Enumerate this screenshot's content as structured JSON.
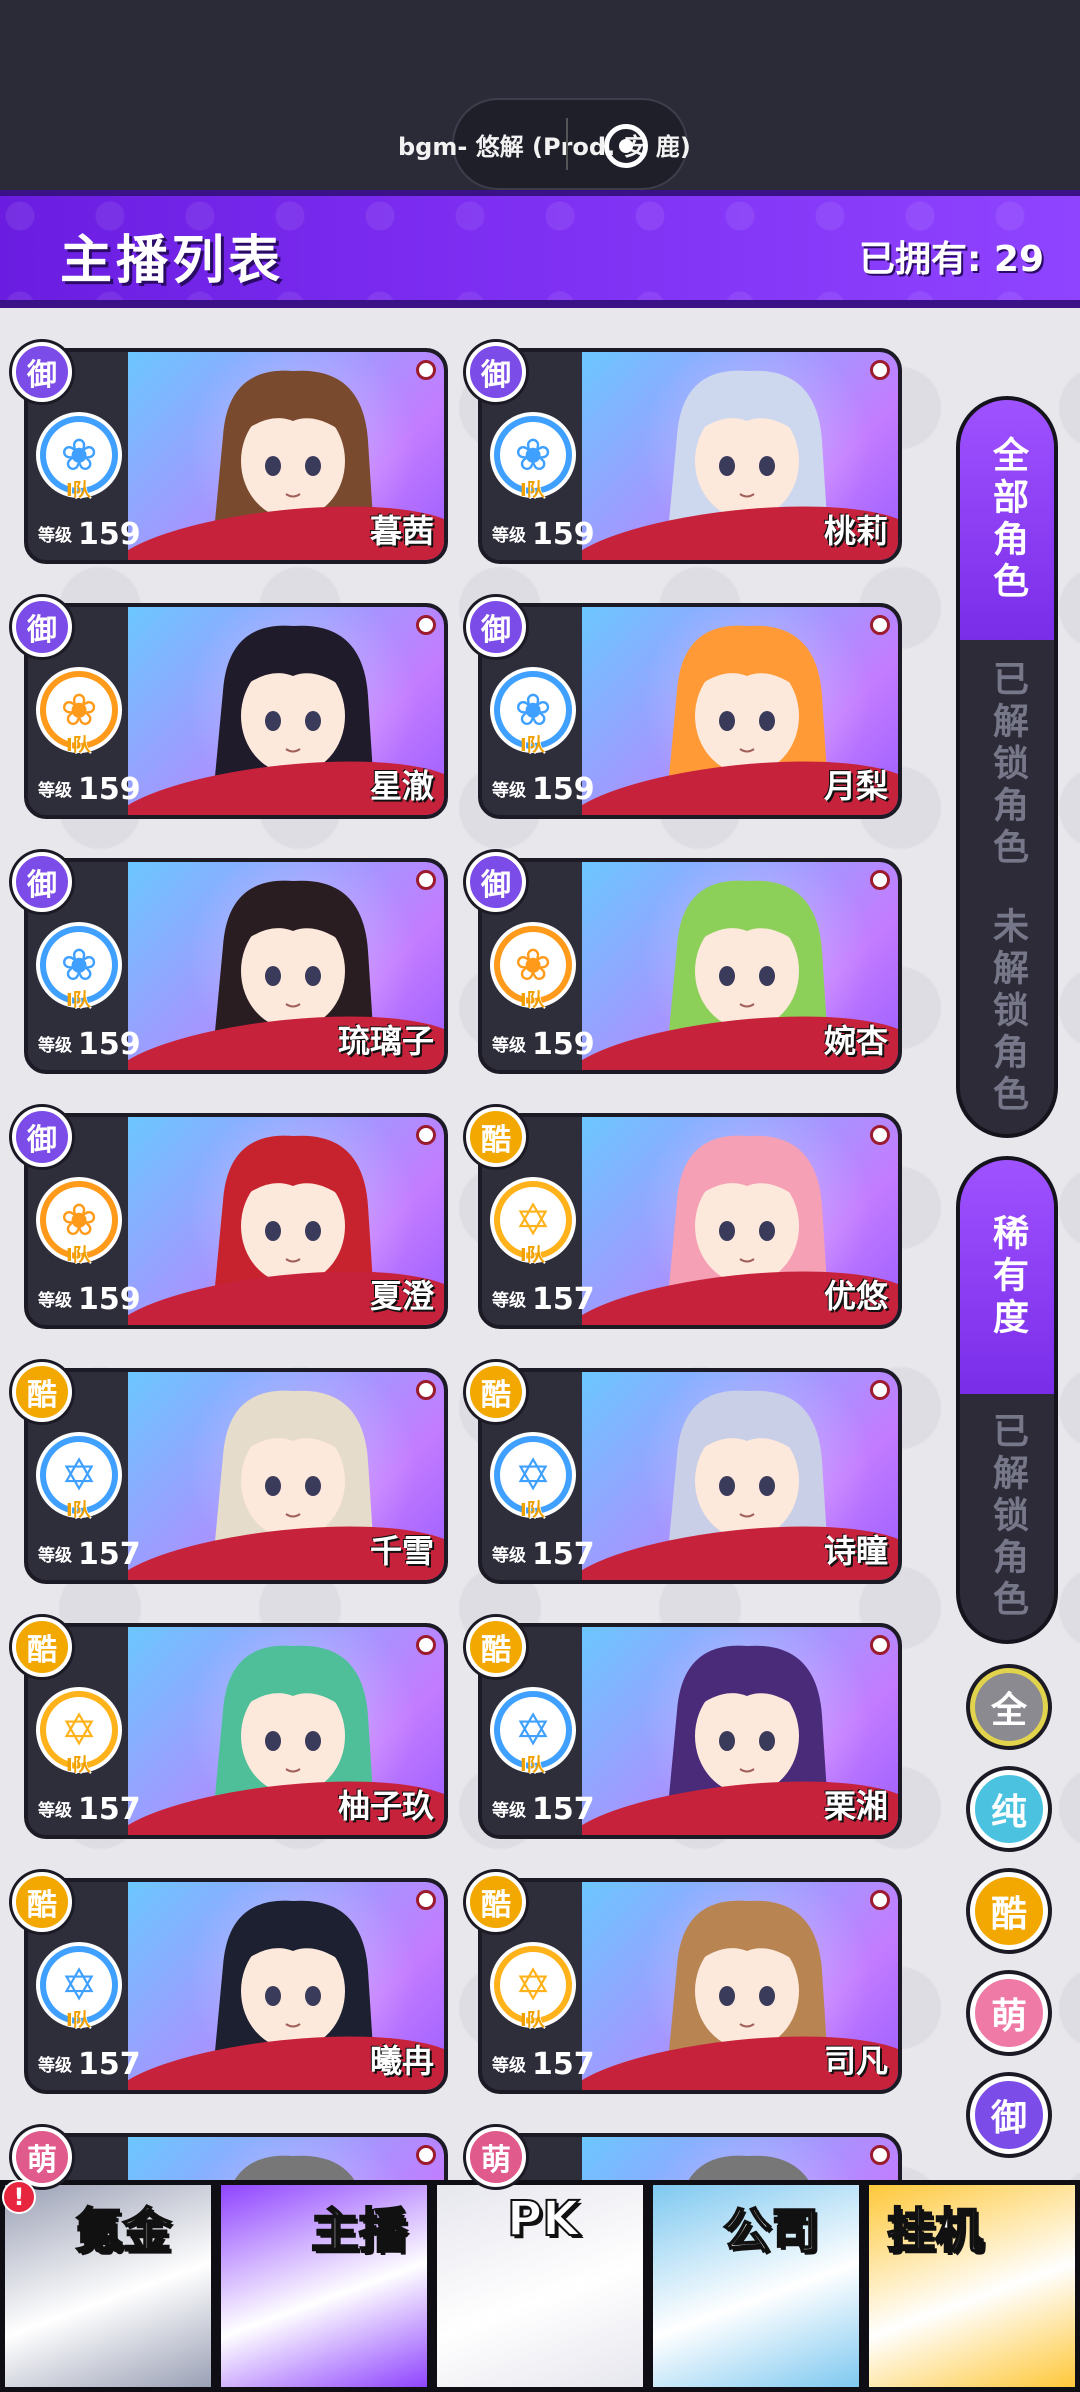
{
  "music": {
    "text": "bgm- 悠解 (Prod. 安 鹿)"
  },
  "header": {
    "title": "主播列表",
    "owned_label": "已拥有: 29"
  },
  "level_label": "等级",
  "cards": [
    {
      "name": "暮茜",
      "level": "159",
      "rarity": "御",
      "rarity_color": "#7c4ce8",
      "emblem_color": "#3fa0ff",
      "tier": "Ⅰ队",
      "art": [
        "#6bc7ff",
        "#c37cff"
      ],
      "hair": "#7a4a2e"
    },
    {
      "name": "桃莉",
      "level": "159",
      "rarity": "御",
      "rarity_color": "#7c4ce8",
      "emblem_color": "#3fa0ff",
      "tier": "Ⅰ队",
      "art": [
        "#6bc7ff",
        "#c37cff"
      ],
      "hair": "#cdd8ee"
    },
    {
      "name": "星澈",
      "level": "159",
      "rarity": "御",
      "rarity_color": "#7c4ce8",
      "emblem_color": "#ff9a1a",
      "tier": "Ⅰ队",
      "art": [
        "#6bc7ff",
        "#c37cff"
      ],
      "hair": "#1f1b2b"
    },
    {
      "name": "月梨",
      "level": "159",
      "rarity": "御",
      "rarity_color": "#7c4ce8",
      "emblem_color": "#3fa0ff",
      "tier": "Ⅰ队",
      "art": [
        "#6bc7ff",
        "#c37cff"
      ],
      "hair": "#ff9a36"
    },
    {
      "name": "琉璃子",
      "level": "159",
      "rarity": "御",
      "rarity_color": "#7c4ce8",
      "emblem_color": "#3fa0ff",
      "tier": "Ⅰ队",
      "art": [
        "#6bc7ff",
        "#c37cff"
      ],
      "hair": "#2a1d22"
    },
    {
      "name": "婉杏",
      "level": "159",
      "rarity": "御",
      "rarity_color": "#7c4ce8",
      "emblem_color": "#ff9a1a",
      "tier": "Ⅰ队",
      "art": [
        "#6bc7ff",
        "#c37cff"
      ],
      "hair": "#8cd05a"
    },
    {
      "name": "夏澄",
      "level": "159",
      "rarity": "御",
      "rarity_color": "#7c4ce8",
      "emblem_color": "#ff9a1a",
      "tier": "Ⅰ队",
      "art": [
        "#6bc7ff",
        "#c37cff"
      ],
      "hair": "#c7232e"
    },
    {
      "name": "优悠",
      "level": "157",
      "rarity": "酷",
      "rarity_color": "#f2a800",
      "emblem_color": "#ffb21a",
      "tier": "Ⅰ队",
      "art": [
        "#6bc7ff",
        "#c37cff"
      ],
      "hair": "#f5a0b4"
    },
    {
      "name": "千雪",
      "level": "157",
      "rarity": "酷",
      "rarity_color": "#f2a800",
      "emblem_color": "#3fa0ff",
      "tier": "Ⅰ队",
      "art": [
        "#6bc7ff",
        "#c37cff"
      ],
      "hair": "#e6dccb"
    },
    {
      "name": "诗瞳",
      "level": "157",
      "rarity": "酷",
      "rarity_color": "#f2a800",
      "emblem_color": "#3fa0ff",
      "tier": "Ⅰ队",
      "art": [
        "#6bc7ff",
        "#c37cff"
      ],
      "hair": "#c9cfe6"
    },
    {
      "name": "柚子玖",
      "level": "157",
      "rarity": "酷",
      "rarity_color": "#f2a800",
      "emblem_color": "#ffb21a",
      "tier": "Ⅰ队",
      "art": [
        "#6bc7ff",
        "#c37cff"
      ],
      "hair": "#4fbf9a"
    },
    {
      "name": "栗湘",
      "level": "157",
      "rarity": "酷",
      "rarity_color": "#f2a800",
      "emblem_color": "#3fa0ff",
      "tier": "Ⅰ队",
      "art": [
        "#6bc7ff",
        "#c37cff"
      ],
      "hair": "#4a2b7a"
    },
    {
      "name": "曦冉",
      "level": "157",
      "rarity": "酷",
      "rarity_color": "#f2a800",
      "emblem_color": "#3fa0ff",
      "tier": "Ⅰ队",
      "art": [
        "#6bc7ff",
        "#c37cff"
      ],
      "hair": "#1c2030"
    },
    {
      "name": "司凡",
      "level": "157",
      "rarity": "酷",
      "rarity_color": "#f2a800",
      "emblem_color": "#ffb21a",
      "tier": "Ⅰ队",
      "art": [
        "#6bc7ff",
        "#c37cff"
      ],
      "hair": "#b88452"
    },
    {
      "name": "",
      "level": "",
      "rarity": "萌",
      "rarity_color": "#e05a8c",
      "emblem_color": "#3fa0ff",
      "tier": "",
      "art": [
        "#6bc7ff",
        "#c37cff"
      ],
      "hair": "#777"
    },
    {
      "name": "",
      "level": "",
      "rarity": "萌",
      "rarity_color": "#e05a8c",
      "emblem_color": "#3fa0ff",
      "tier": "",
      "art": [
        "#6bc7ff",
        "#c37cff"
      ],
      "hair": "#777"
    }
  ],
  "filters": {
    "group1": [
      {
        "label": "全部角色",
        "active": true
      },
      {
        "label": "已解锁角色",
        "active": false
      },
      {
        "label": "未解锁角色",
        "active": false
      }
    ],
    "group2": [
      {
        "label": "稀有度",
        "active": true
      },
      {
        "label": "已解锁角色",
        "active": false
      }
    ],
    "rarity": [
      {
        "label": "全",
        "color": "#8a8a90",
        "ring": "#e2d34d"
      },
      {
        "label": "纯",
        "color": "#4ac2e0",
        "ring": "#fff"
      },
      {
        "label": "酷",
        "color": "#f2a800",
        "ring": "#fff"
      },
      {
        "label": "萌",
        "color": "#ef7aa6",
        "ring": "#fff"
      },
      {
        "label": "御",
        "color": "#7c4ce8",
        "ring": "#fff"
      }
    ]
  },
  "nav": [
    {
      "label": "氪金",
      "color": "#9aa0b5"
    },
    {
      "label": "主播",
      "color": "#8f44ff"
    },
    {
      "label": "PK",
      "color": "#e6e6ee"
    },
    {
      "label": "公司",
      "color": "#7ec8f0"
    },
    {
      "label": "挂机",
      "color": "#ffc83a"
    }
  ],
  "nav_alert": "!"
}
